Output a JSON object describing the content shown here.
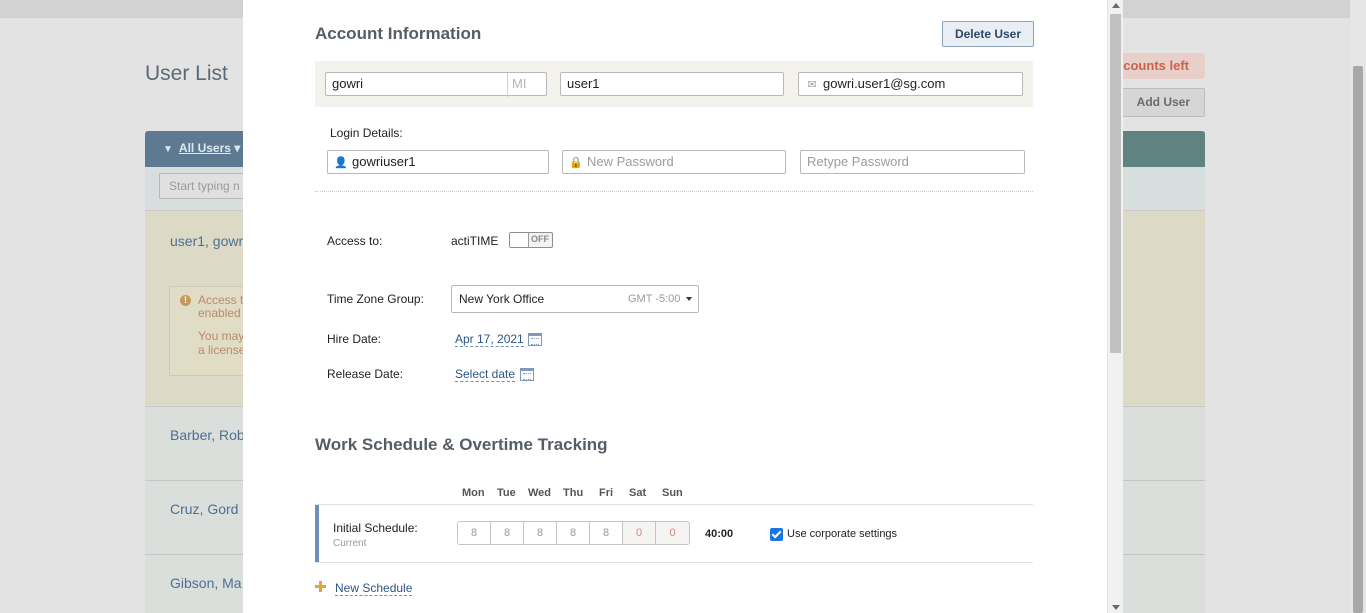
{
  "background": {
    "page_title": "User List",
    "accounts_left": "ccounts left",
    "add_user": "Add User",
    "filter_label": "All Users",
    "search_placeholder": "Start typing n",
    "rows": [
      "user1, gowr",
      "Barber, Rob",
      "Cruz, Gord",
      "Gibson, Ma"
    ],
    "warning_lines": [
      "Access t",
      "enabled",
      "You may",
      "a license"
    ]
  },
  "modal": {
    "account_section_title": "Account Information",
    "delete_user_label": "Delete User",
    "first_name": "gowri",
    "middle_initial_placeholder": "MI",
    "last_name": "user1",
    "email": "gowri.user1@sg.com",
    "login_details_label": "Login Details:",
    "username": "gowriuser1",
    "new_password_placeholder": "New Password",
    "retype_password_placeholder": "Retype Password",
    "access_to_label": "Access to:",
    "access_app": "actiTIME",
    "access_toggle_state": "OFF",
    "timezone_label": "Time Zone Group:",
    "timezone_value": "New York Office",
    "timezone_offset": "GMT -5:00",
    "hire_date_label": "Hire Date:",
    "hire_date_value": "Apr 17, 2021",
    "release_date_label": "Release Date:",
    "release_date_value": "Select date",
    "work_section_title": "Work Schedule & Overtime Tracking",
    "days": [
      "Mon",
      "Tue",
      "Wed",
      "Thu",
      "Fri",
      "Sat",
      "Sun"
    ],
    "initial_schedule_label": "Initial Schedule:",
    "initial_schedule_sub": "Current",
    "hours": [
      "8",
      "8",
      "8",
      "8",
      "8",
      "0",
      "0"
    ],
    "total_hours": "40:00",
    "use_corporate_label": "Use corporate settings",
    "use_corporate_checked": true,
    "new_schedule_label": "New Schedule"
  },
  "colors": {
    "accent_blue": "#2d5588",
    "schedule_bar": "#6b91b7",
    "new_schedule_plus": "#e8a33c",
    "checkbox": "#1a73e8"
  }
}
